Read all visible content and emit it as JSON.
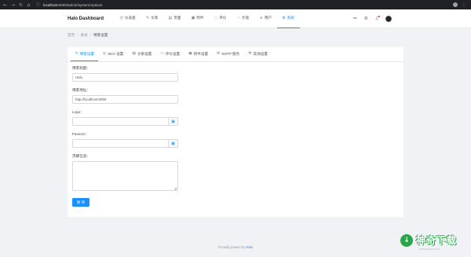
{
  "browser": {
    "url_host": "localhost",
    "url_path": ":8090/admin/system/options",
    "nav_icons": [
      "back-icon",
      "forward-icon",
      "reload-icon",
      "home-icon"
    ]
  },
  "header": {
    "brand": "Halo Dashboard",
    "menu": [
      {
        "label": "仪表盘",
        "icon": "dashboard-icon",
        "glyph": "◷"
      },
      {
        "label": "文章",
        "icon": "edit-icon",
        "glyph": "✎"
      },
      {
        "label": "页面",
        "icon": "page-icon",
        "glyph": "▤"
      },
      {
        "label": "附件",
        "icon": "picture-icon",
        "glyph": "▣"
      },
      {
        "label": "评论",
        "icon": "comment-icon",
        "glyph": "◌"
      },
      {
        "label": "外观",
        "icon": "skin-icon",
        "glyph": "♢"
      },
      {
        "label": "用户",
        "icon": "user-icon",
        "glyph": "♙"
      },
      {
        "label": "系统",
        "icon": "setting-icon",
        "glyph": "⚙",
        "active": true
      }
    ],
    "right_icons": [
      "link-icon",
      "gear-icon",
      "bell-icon"
    ]
  },
  "breadcrumb": {
    "items": [
      "首页",
      "系统"
    ],
    "current": "博客设置",
    "separator": "/"
  },
  "tabs": [
    {
      "label": "博客设置",
      "icon": "edit-icon",
      "glyph": "✎",
      "active": true
    },
    {
      "label": "SEO 设置",
      "icon": "global-icon",
      "glyph": "◎"
    },
    {
      "label": "文章设置",
      "icon": "article-icon",
      "glyph": "▤"
    },
    {
      "label": "评论设置",
      "icon": "comment-icon",
      "glyph": "▭"
    },
    {
      "label": "附件设置",
      "icon": "picture-icon",
      "glyph": "▣"
    },
    {
      "label": "SMTP 服务",
      "icon": "mail-icon",
      "glyph": "✉"
    },
    {
      "label": "其他设置",
      "icon": "tool-icon",
      "glyph": "⚒"
    }
  ],
  "form": {
    "blog_title_label": "博客标题：",
    "blog_title_value": "Halo",
    "blog_url_label": "博客地址：",
    "blog_url_value": "http://localhost:8090",
    "logo_label": "Logo：",
    "logo_value": "",
    "favicon_label": "Favicon：",
    "favicon_value": "",
    "footer_label": "页脚信息：",
    "footer_value": "",
    "picker_icon": "picture-icon",
    "save_label": "保 存"
  },
  "footer": {
    "prefix": "Proudly power by",
    "link": "Halo"
  },
  "watermark": {
    "title": "神奇下载",
    "subtitle": "www.sqxz.com"
  },
  "colors": {
    "accent": "#1890ff",
    "chrome": "#202124",
    "background": "#f0f2f5"
  }
}
